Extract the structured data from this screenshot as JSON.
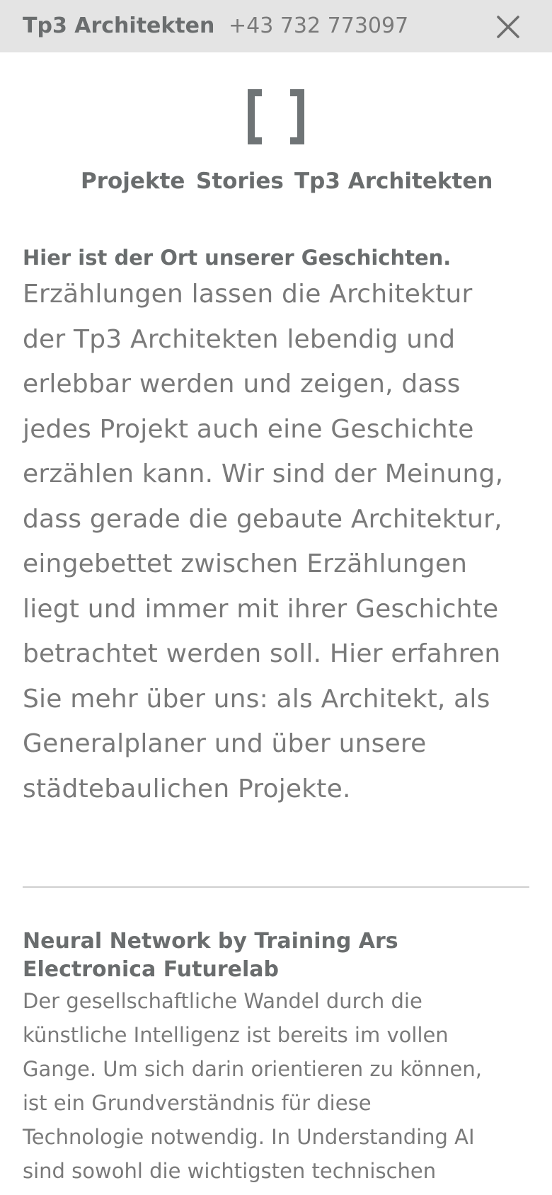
{
  "header": {
    "brand": "Tp3 Architekten",
    "phone": "+43 732 773097",
    "close_icon": "close-icon"
  },
  "logo": {
    "icon": "brackets-logo",
    "color": "#6f7476"
  },
  "nav": {
    "items": [
      {
        "label": "Projekte"
      },
      {
        "label": "Stories"
      },
      {
        "label": "Tp3 Architekten"
      }
    ]
  },
  "intro": {
    "heading": "Hier ist der Ort unserer Geschichten.",
    "lines": [
      "Erzählungen lassen die Architektur",
      "der Tp3 Architekten lebendig und",
      "erlebbar werden und zeigen, dass",
      "jedes Projekt auch eine Geschichte",
      "erzählen kann. Wir sind der Meinung,",
      "dass gerade die gebaute Architektur,",
      "eingebettet zwischen Erzählungen",
      "liegt und immer mit ihrer Geschichte",
      "betrachtet werden soll. Hier erfahren",
      "Sie mehr über uns: als Architekt, als",
      "Generalplaner und über unsere",
      "städtebaulichen Projekte."
    ]
  },
  "story": {
    "title": "Neural Network by Training Ars Electronica Futurelab",
    "lines": [
      "Der gesellschaftliche Wandel durch die",
      "künstliche Intelligenz ist bereits im vollen",
      "Gange. Um sich darin orientieren zu können,",
      "ist ein Grundverständnis für diese",
      "Technologie notwendig. In Understanding AI",
      "sind sowohl die wichtigsten technischen"
    ]
  },
  "colors": {
    "header_bg": "#e4e4e4",
    "text": "#7a7a7a",
    "heading": "#6a6d6e",
    "divider": "#cfcfcf"
  }
}
